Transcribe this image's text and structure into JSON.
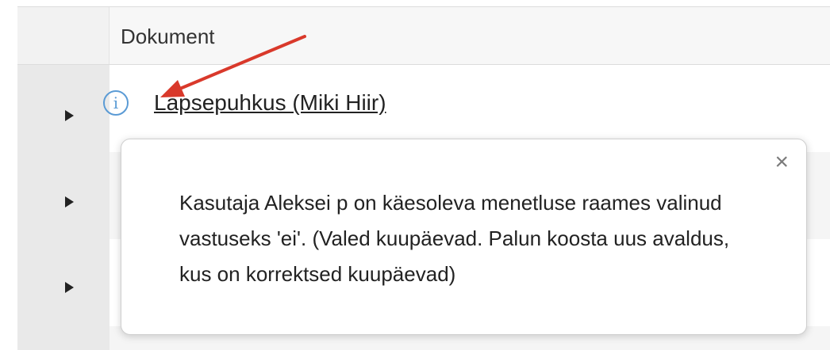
{
  "table": {
    "column_header": "Dokument",
    "rows": [
      {
        "document_link": "Lapsepuhkus (Miki Hiir)"
      }
    ]
  },
  "popover": {
    "close_symbol": "×",
    "message": "Kasutaja Aleksei p on käesoleva menetluse raames valinud vastuseks 'ei'. (Valed kuupäevad. Palun koosta uus avaldus, kus on korrektsed kuupäevad)"
  },
  "icons": {
    "info": "i",
    "expander": "triangle-right",
    "annotation_arrow": "red-arrow"
  },
  "colors": {
    "info_icon": "#5b9bd5",
    "annotation_arrow": "#d9392b"
  }
}
